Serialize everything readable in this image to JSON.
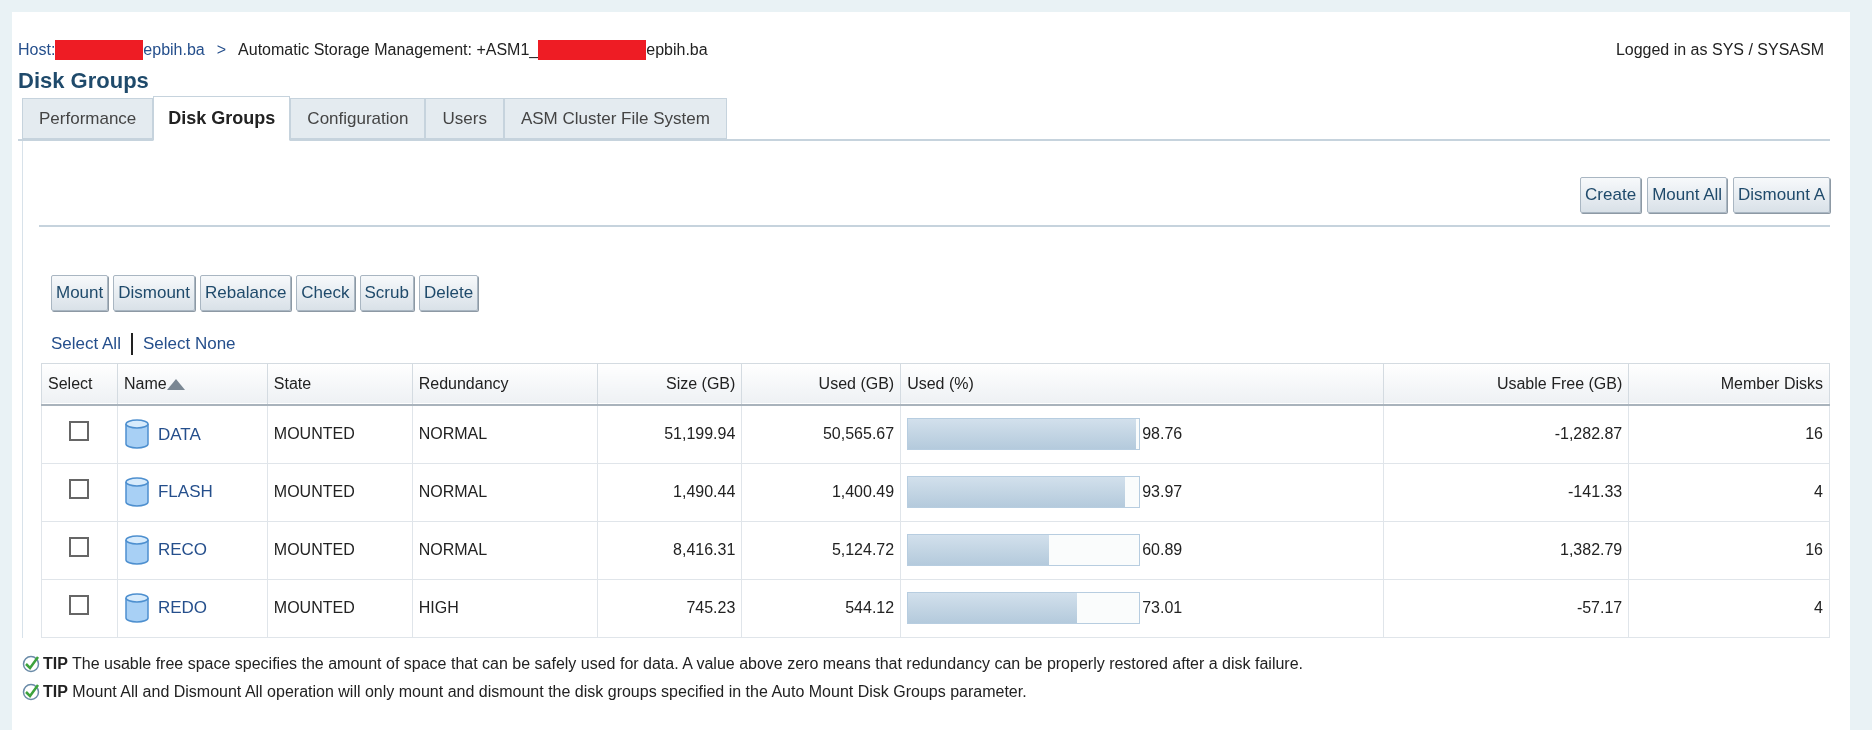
{
  "breadcrumb": {
    "host_label": "Host:",
    "host_suffix": "epbih.ba",
    "separator": ">",
    "target_prefix": "Automatic Storage Management: +ASM1_",
    "target_suffix": "epbih.ba"
  },
  "login": "Logged in as SYS / SYSASM",
  "page_title": "Disk Groups",
  "tabs": [
    {
      "label": "Performance",
      "selected": false
    },
    {
      "label": "Disk Groups",
      "selected": true
    },
    {
      "label": "Configuration",
      "selected": false
    },
    {
      "label": "Users",
      "selected": false
    },
    {
      "label": "ASM Cluster File System",
      "selected": false
    }
  ],
  "top_buttons": [
    "Create",
    "Mount All",
    "Dismount A"
  ],
  "action_buttons": [
    "Mount",
    "Dismount",
    "Rebalance",
    "Check",
    "Scrub",
    "Delete"
  ],
  "select_links": [
    "Select All",
    "Select None"
  ],
  "table": {
    "columns": [
      "Select",
      "Name",
      "State",
      "Redundancy",
      "Size (GB)",
      "Used (GB)",
      "Used (%)",
      "Usable Free (GB)",
      "Member Disks"
    ],
    "rows": [
      {
        "checked": false,
        "name": "DATA",
        "state": "MOUNTED",
        "redundancy": "NORMAL",
        "size": "51,199.94",
        "used": "50,565.67",
        "level": 0.9876,
        "used_pct": "98.76",
        "usable_free": "-1,282.87",
        "member_disks": "16"
      },
      {
        "checked": false,
        "name": "FLASH",
        "state": "MOUNTED",
        "redundancy": "NORMAL",
        "size": "1,490.44",
        "used": "1,400.49",
        "level": 0.9397,
        "used_pct": "93.97",
        "usable_free": "-141.33",
        "member_disks": "4"
      },
      {
        "checked": false,
        "name": "RECO",
        "state": "MOUNTED",
        "redundancy": "NORMAL",
        "size": "8,416.31",
        "used": "5,124.72",
        "level": 0.6089,
        "used_pct": "60.89",
        "usable_free": "1,382.79",
        "member_disks": "16"
      },
      {
        "checked": false,
        "name": "REDO",
        "state": "MOUNTED",
        "redundancy": "HIGH",
        "size": "745.23",
        "used": "544.12",
        "level": 0.7301,
        "used_pct": "73.01",
        "usable_free": "-57.17",
        "member_disks": "4"
      }
    ]
  },
  "tips": [
    "**TIP** The usable free space specifies the amount of space that can be safely used for data. A value above zero means that redundancy can be properly restored after a disk failure.",
    "**TIP** Mount All and Dismount All operation will only mount and dismount the disk groups specified in the Auto Mount Disk Groups parameter."
  ]
}
